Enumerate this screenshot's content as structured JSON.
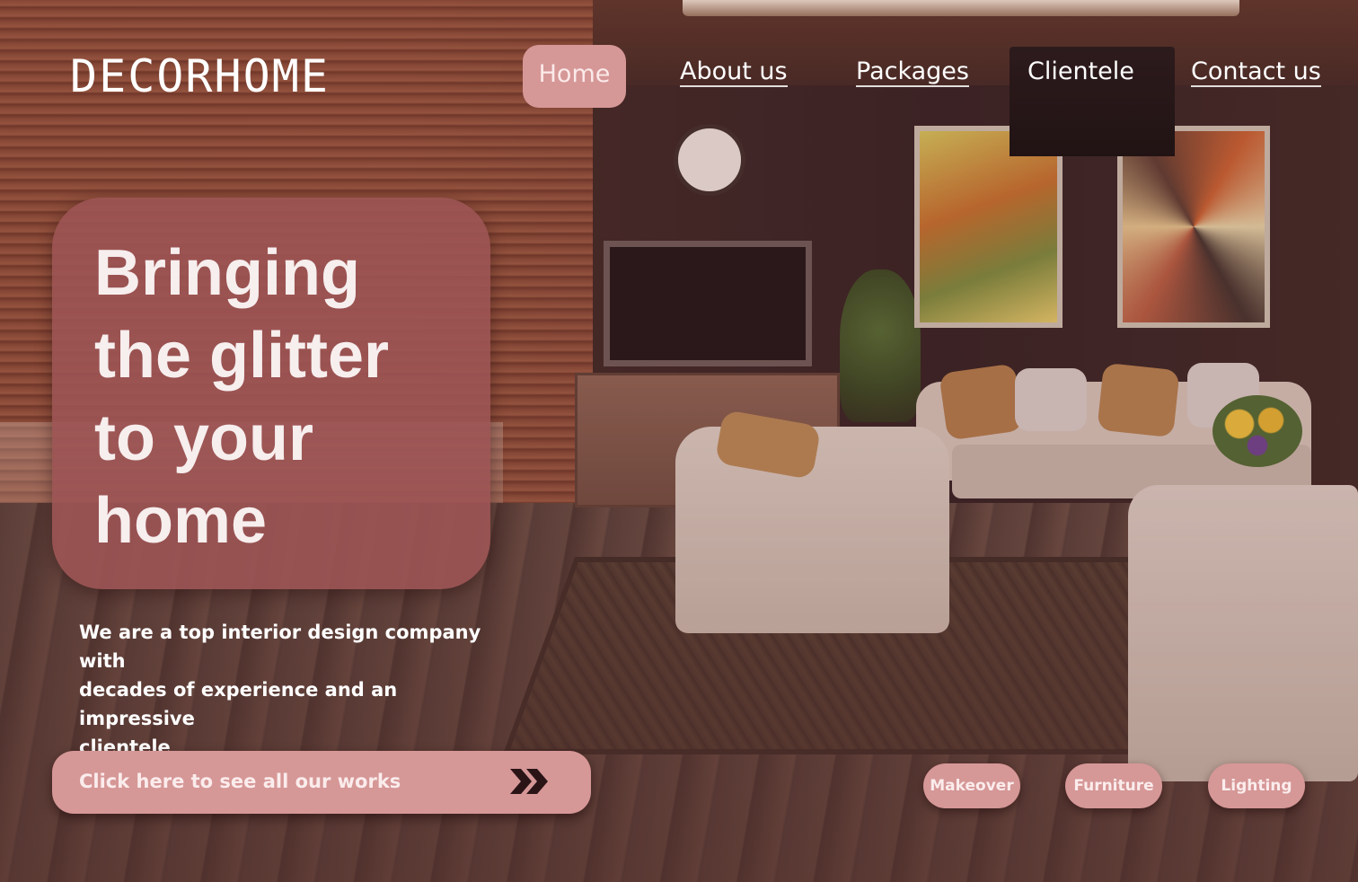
{
  "brand": {
    "logo_text": "DECORHOME"
  },
  "nav": {
    "items": [
      {
        "label": "Home",
        "active": true
      },
      {
        "label": "About us",
        "active": false
      },
      {
        "label": "Packages",
        "active": false
      },
      {
        "label": "Clientele",
        "active": false
      },
      {
        "label": "Contact us",
        "active": false
      }
    ]
  },
  "hero": {
    "title_lines": [
      "Bringing",
      "the glitter",
      "to your",
      "home"
    ],
    "subtitle_lines": [
      "We are a top interior design company with",
      "decades of experience and an impressive",
      "clientele"
    ]
  },
  "cta": {
    "label": "Click here to see all our works",
    "icon": "double-chevron-right-icon"
  },
  "categories": [
    {
      "label": "Makeover"
    },
    {
      "label": "Furniture"
    },
    {
      "label": "Lighting"
    }
  ],
  "colors": {
    "accent_pink": "#d69797",
    "hero_card": "#9c5454",
    "text_light": "#ffffff"
  }
}
